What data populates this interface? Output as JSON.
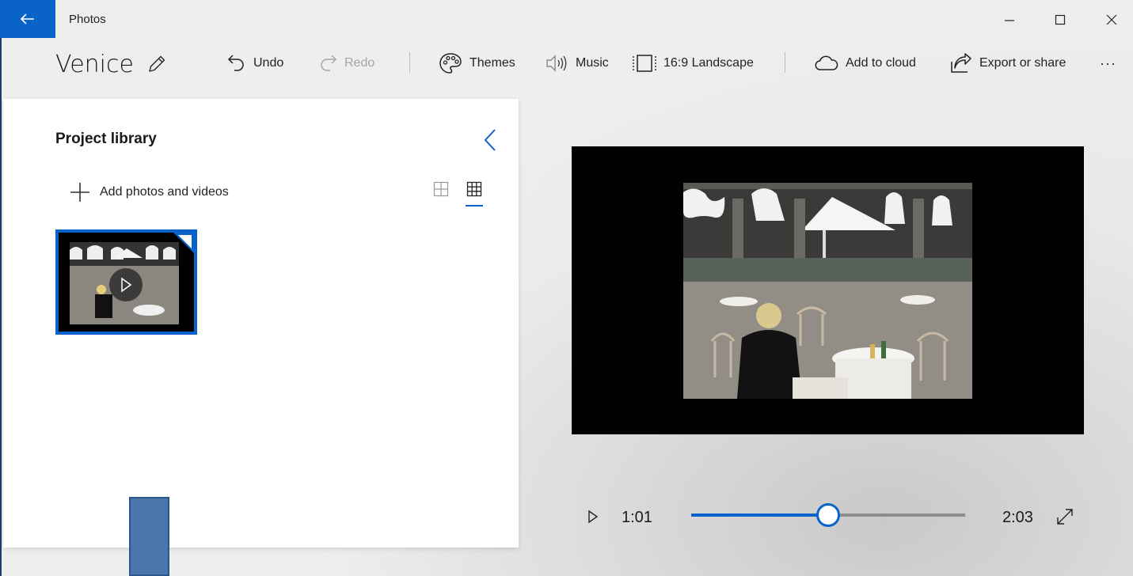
{
  "titlebar": {
    "app_title": "Photos",
    "back_icon": "arrow-left-icon",
    "minimize_icon": "minimize-icon",
    "maximize_icon": "maximize-icon",
    "close_icon": "close-icon"
  },
  "toolbar": {
    "project_name": "Venice",
    "undo_label": "Undo",
    "redo_label": "Redo",
    "themes_label": "Themes",
    "music_label": "Music",
    "aspect_label": "16:9 Landscape",
    "cloud_label": "Add to cloud",
    "export_label": "Export or share",
    "more_label": "···"
  },
  "library": {
    "title": "Project library",
    "add_label": "Add photos and videos",
    "selected_view": "small-grid"
  },
  "player": {
    "current_time": "1:01",
    "total_time": "2:03",
    "progress": 0.5
  },
  "colors": {
    "accent": "#0a63c9"
  }
}
